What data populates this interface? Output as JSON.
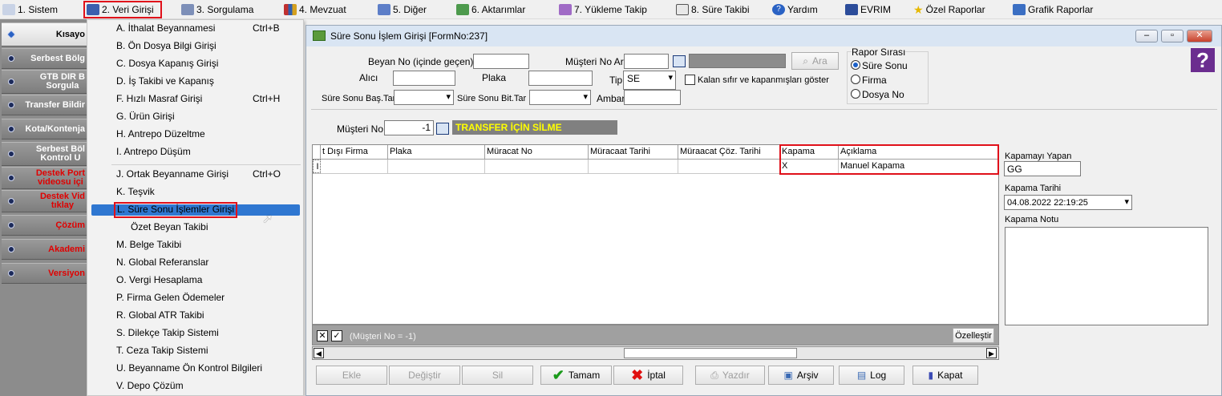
{
  "menubar": [
    {
      "label": "1.  Sistem",
      "icon": "system-icon"
    },
    {
      "label": "2.  Veri Girişi",
      "icon": "pencil-icon"
    },
    {
      "label": "3.  Sorgulama",
      "icon": "query-icon"
    },
    {
      "label": "4.  Mevzuat",
      "icon": "books-icon"
    },
    {
      "label": "5.  Diğer",
      "icon": "other-icon"
    },
    {
      "label": "6.  Aktarımlar",
      "icon": "transfer-icon"
    },
    {
      "label": "7.  Yükleme Takip",
      "icon": "tracking-icon"
    },
    {
      "label": "8. Süre Takibi",
      "icon": "calendar-icon"
    },
    {
      "label": "Yardım",
      "icon": "help-icon"
    },
    {
      "label": "EVRIM",
      "icon": "evrim-icon"
    },
    {
      "label": "Özel Raporlar",
      "icon": "star-icon"
    },
    {
      "label": "Grafik Raporlar",
      "icon": "chart-icon"
    }
  ],
  "sidebar": {
    "header": "Kısayo",
    "items": [
      "Serbest Bölg",
      "GTB DIR B\nSorgula",
      "Transfer Bildir",
      "Kota/Kontenja",
      "Serbest Böl\nKontrol U",
      "Destek Port\nvideosu içi",
      "Destek Vid\ntıklay",
      "Çözüm",
      "Akademi",
      "Versiyon"
    ]
  },
  "dropdown": {
    "items": [
      {
        "label": "A.  İthalat Beyannamesi",
        "shortcut": "Ctrl+B"
      },
      {
        "label": "B.  Ön Dosya Bilgi Girişi",
        "shortcut": ""
      },
      {
        "label": "C.  Dosya Kapanış Girişi",
        "shortcut": ""
      },
      {
        "label": "D.  İş Takibi ve Kapanış",
        "shortcut": ""
      },
      {
        "label": "F.  Hızlı Masraf Girişi",
        "shortcut": "Ctrl+H"
      },
      {
        "label": "G.  Ürün Girişi",
        "shortcut": ""
      },
      {
        "label": "H.  Antrepo Düzeltme",
        "shortcut": ""
      },
      {
        "label": "I.  Antrepo Düşüm",
        "shortcut": ""
      },
      {
        "label": "J.  Ortak Beyanname Girişi",
        "shortcut": "Ctrl+O"
      },
      {
        "label": "K.  Teşvik",
        "shortcut": ""
      },
      {
        "label": "L.  Süre Sonu İşlemler Girişi",
        "shortcut": ""
      },
      {
        "label": "Özet Beyan Takibi",
        "shortcut": ""
      },
      {
        "label": "M.  Belge Takibi",
        "shortcut": ""
      },
      {
        "label": "N.  Global Referanslar",
        "shortcut": ""
      },
      {
        "label": "O. Vergi Hesaplama",
        "shortcut": ""
      },
      {
        "label": "P. Firma Gelen Ödemeler",
        "shortcut": ""
      },
      {
        "label": "R. Global ATR Takibi",
        "shortcut": ""
      },
      {
        "label": "S. Dilekçe Takip Sistemi",
        "shortcut": ""
      },
      {
        "label": "T. Ceza Takip Sistemi",
        "shortcut": ""
      },
      {
        "label": "U. Beyanname Ön Kontrol Bilgileri",
        "shortcut": ""
      },
      {
        "label": "V. Depo Çözüm",
        "shortcut": ""
      }
    ]
  },
  "window": {
    "title": "Süre Sonu İşlem Girişi [FormNo:237]",
    "min": "–",
    "max": "▫",
    "close": "✕"
  },
  "form": {
    "beyan_no_label": "Beyan No (içinde geçen)",
    "musteri_ara_label": "Müşteri No Ara",
    "ara_button": "Ara",
    "alici_label": "Alıcı",
    "plaka_label": "Plaka",
    "tip_label": "Tip",
    "tip_value": "SE",
    "kalan_label": "Kalan sıfır ve kapanmışları göster",
    "bas_tar_label": "Süre Sonu Baş.Tar",
    "bit_tar_label": "Süre Sonu Bit.Tar",
    "ambar_label": "Ambar",
    "rapor_title": "Rapor Sırası",
    "rapor_options": [
      "Süre Sonu",
      "Firma",
      "Dosya No"
    ],
    "musteri_no_label": "Müşteri No",
    "musteri_no_value": "-1",
    "transfer_label": "TRANSFER İÇİN SİLME"
  },
  "grid": {
    "headers": [
      "t Dışı Firma",
      "Plaka",
      "Müracat No",
      "Müracaat Tarihi",
      "Müraacat Çöz. Tarihi",
      "Kapama",
      "Açıklama"
    ],
    "row": [
      "I",
      "",
      "",
      "",
      "",
      "",
      "X",
      "Manuel Kapama"
    ],
    "filter_text": "(Müşteri No = -1)",
    "customize": "Özelleştir"
  },
  "side_panel": {
    "kapamayi_yapan_label": "Kapamayı Yapan",
    "kapamayi_yapan_value": "GG",
    "kapama_tarihi_label": "Kapama Tarihi",
    "kapama_tarihi_value": "04.08.2022 22:19:25",
    "kapama_notu_label": "Kapama Notu"
  },
  "buttons": {
    "ekle": "Ekle",
    "degistir": "Değiştir",
    "sil": "Sil",
    "tamam": "Tamam",
    "iptal": "İptal",
    "yazdir": "Yazdır",
    "arsiv": "Arşiv",
    "log": "Log",
    "kapat": "Kapat"
  },
  "colors": {
    "highlight": "#e0101a",
    "selection": "#2f77d1",
    "banner_text": "#ffff00",
    "banner_bg": "#808080"
  }
}
